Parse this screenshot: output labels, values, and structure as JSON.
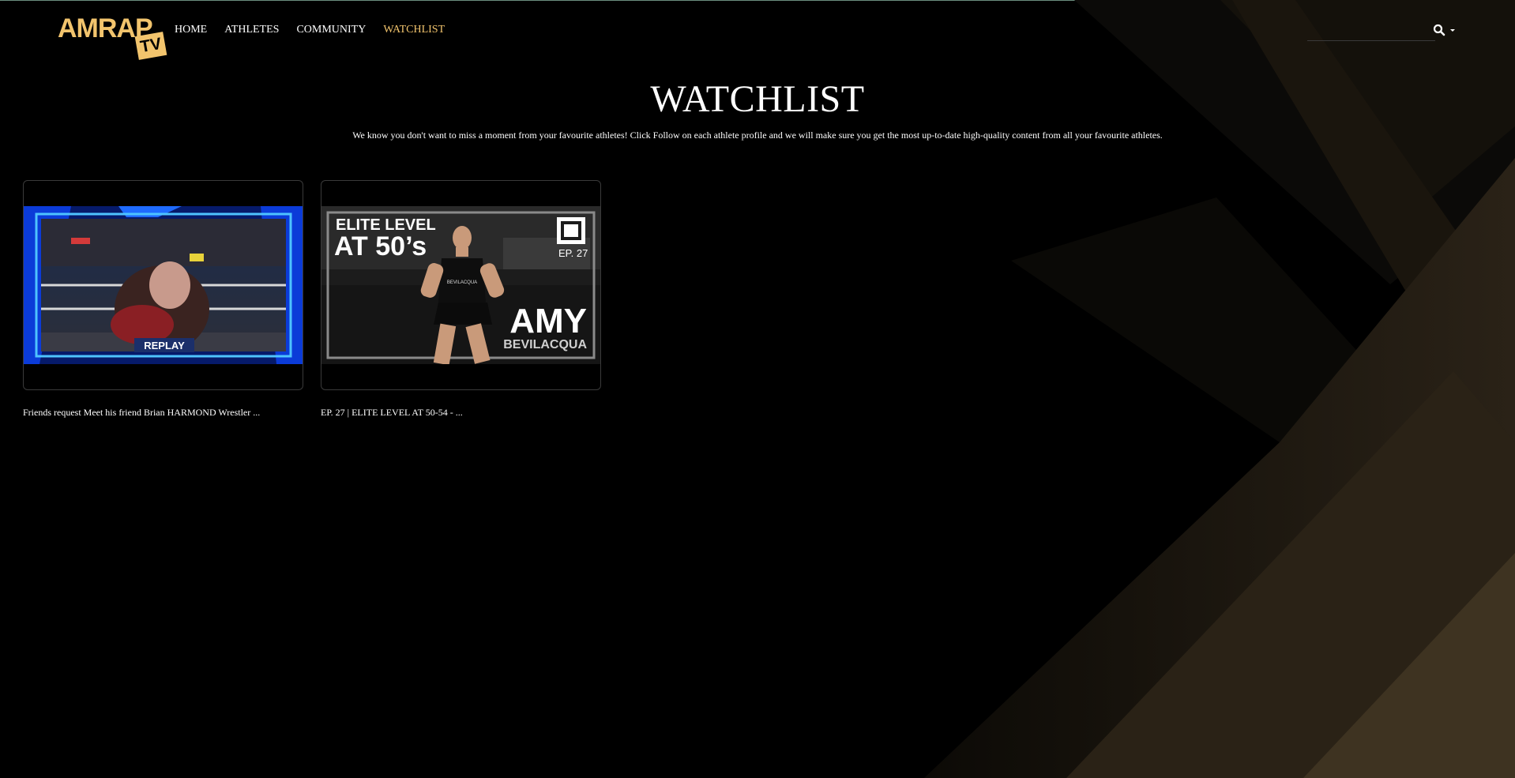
{
  "app": {
    "logo_main": "AMRAP",
    "logo_badge": "TV"
  },
  "nav": {
    "items": [
      {
        "label": "HOME",
        "active": false
      },
      {
        "label": "ATHLETES",
        "active": false
      },
      {
        "label": "COMMUNITY",
        "active": false
      },
      {
        "label": "WATCHLIST",
        "active": true
      }
    ]
  },
  "search": {
    "value": "",
    "placeholder": "",
    "icon": "search-icon"
  },
  "page": {
    "title": "WATCHLIST",
    "subtitle": "We know you don't want to miss a moment from your favourite athletes! Click Follow on each athlete profile and we will make sure you get the most up-to-date high-quality content from all your favourite athletes."
  },
  "videos": [
    {
      "title": "Friends request Meet his friend Brian HARMOND Wrestler ...",
      "thumb_label": "REPLAY"
    },
    {
      "title": "EP. 27 | ELITE LEVEL AT 50-54 - ...",
      "thumb_heading_line1": "ELITE LEVEL",
      "thumb_heading_line2": "AT 50’s",
      "thumb_episode": "EP. 27",
      "thumb_name_first": "AMY",
      "thumb_name_last": "BEVILACQUA",
      "thumb_shirt_text": "BEVILACQUA"
    }
  ],
  "colors": {
    "accent": "#f2c46d",
    "background": "#000000",
    "decor_gold": "#4a3c22"
  }
}
